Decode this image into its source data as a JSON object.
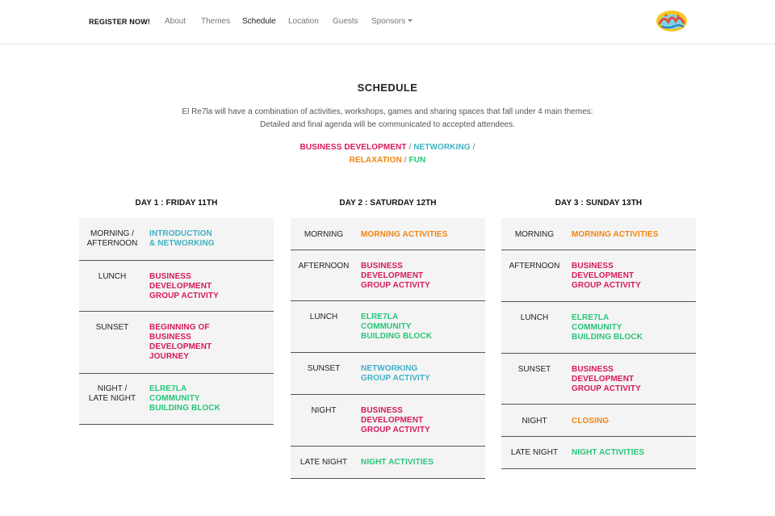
{
  "nav": {
    "register": "REGISTER NOW!",
    "about": "About",
    "themes": "Themes",
    "schedule": "Schedule",
    "location": "Location",
    "guests": "Guests",
    "sponsors": "Sponsors"
  },
  "logo": {
    "icon": "el-re7la-logo"
  },
  "colors": {
    "business": "#d6195f",
    "networking": "#41b1c6",
    "relaxation": "#f0850f",
    "fun": "#27c57a"
  },
  "header": {
    "title": "SCHEDULE",
    "intro_line1": "El Re7la will have a combination of activities, workshops, games and sharing spaces that fall under 4 main themes:",
    "intro_line2": "Detailed and final agenda will be communicated to accepted attendees.",
    "themes": {
      "business": "BUSINESS DEVELOPMENT",
      "networking": "NETWORKING",
      "relaxation": "RELAXATION",
      "fun": "FUN",
      "separator": " / "
    }
  },
  "days": [
    {
      "title": "DAY 1 : FRIDAY 11TH",
      "slots": [
        {
          "time": "MORNING /\nAFTERNOON",
          "activity": "INTRODUCTION\n& NETWORKING",
          "theme": "networking"
        },
        {
          "time": "LUNCH",
          "activity": "BUSINESS\nDEVELOPMENT\nGROUP ACTIVITY",
          "theme": "business"
        },
        {
          "time": "SUNSET",
          "activity": "BEGINNING OF\nBUSINESS\nDEVELOPMENT\nJOURNEY",
          "theme": "business"
        },
        {
          "time": "NIGHT /\nLATE NIGHT",
          "activity": "ELRE7LA\nCOMMUNITY\nBUILDING BLOCK",
          "theme": "fun"
        }
      ]
    },
    {
      "title": "DAY 2 : SATURDAY 12TH",
      "slots": [
        {
          "time": "MORNING",
          "activity": "MORNING ACTIVITIES",
          "theme": "relaxation"
        },
        {
          "time": "AFTERNOON",
          "activity": "BUSINESS\nDEVELOPMENT\nGROUP ACTIVITY",
          "theme": "business"
        },
        {
          "time": "LUNCH",
          "activity": "ELRE7LA\nCOMMUNITY\nBUILDING BLOCK",
          "theme": "fun"
        },
        {
          "time": "SUNSET",
          "activity": "NETWORKING\nGROUP ACTIVITY",
          "theme": "networking"
        },
        {
          "time": "NIGHT",
          "activity": "BUSINESS\nDEVELOPMENT\nGROUP ACTIVITY",
          "theme": "business"
        },
        {
          "time": "LATE NIGHT",
          "activity": "NIGHT ACTIVITIES",
          "theme": "fun"
        }
      ]
    },
    {
      "title": "DAY 3 : SUNDAY 13TH",
      "slots": [
        {
          "time": "MORNING",
          "activity": "MORNING ACTIVITIES",
          "theme": "relaxation"
        },
        {
          "time": "AFTERNOON",
          "activity": "BUSINESS\nDEVELOPMENT\nGROUP ACTIVITY",
          "theme": "business"
        },
        {
          "time": "LUNCH",
          "activity": "ELRE7LA\nCOMMUNITY\nBUILDING BLOCK",
          "theme": "fun"
        },
        {
          "time": "SUNSET",
          "activity": "BUSINESS\nDEVELOPMENT\nGROUP ACTIVITY",
          "theme": "business"
        },
        {
          "time": "NIGHT",
          "activity": "CLOSING",
          "theme": "relaxation"
        },
        {
          "time": "LATE NIGHT",
          "activity": "NIGHT ACTIVITIES",
          "theme": "fun"
        }
      ]
    }
  ]
}
